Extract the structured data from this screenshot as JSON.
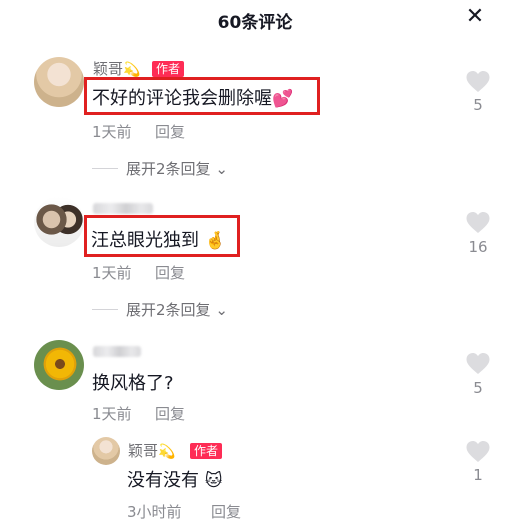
{
  "header": {
    "title": "60条评论",
    "close_icon": "close-icon"
  },
  "comments": [
    {
      "avatar": "avatar-blonde-woman",
      "name": "颖哥",
      "name_decoration": "💫",
      "badge": "作者",
      "text": "不好的评论我会删除喔",
      "emoji": "💕",
      "time": "1天前",
      "reply_label": "回复",
      "expand_label": "展开2条回复",
      "likes": "5",
      "highlighted": true
    },
    {
      "avatar": "avatar-two-men",
      "name": "",
      "text": "汪总眼光独到",
      "emoji": "🤞",
      "time": "1天前",
      "reply_label": "回复",
      "expand_label": "展开2条回复",
      "likes": "16",
      "highlighted": true
    },
    {
      "avatar": "avatar-sunflower",
      "name": "",
      "text": "换风格了?",
      "time": "1天前",
      "reply_label": "回复",
      "likes": "5",
      "replies": [
        {
          "avatar": "avatar-blonde-woman",
          "name": "颖哥",
          "name_decoration": "💫",
          "badge": "作者",
          "text": "没有没有",
          "emoji": "🐱",
          "time": "3小时前",
          "reply_label": "回复",
          "likes": "1"
        }
      ]
    }
  ],
  "colors": {
    "accent": "#fe2c55",
    "highlight_box": "#e02020",
    "meta_text": "#8a8b91",
    "like_icon": "#dcdcdf"
  }
}
